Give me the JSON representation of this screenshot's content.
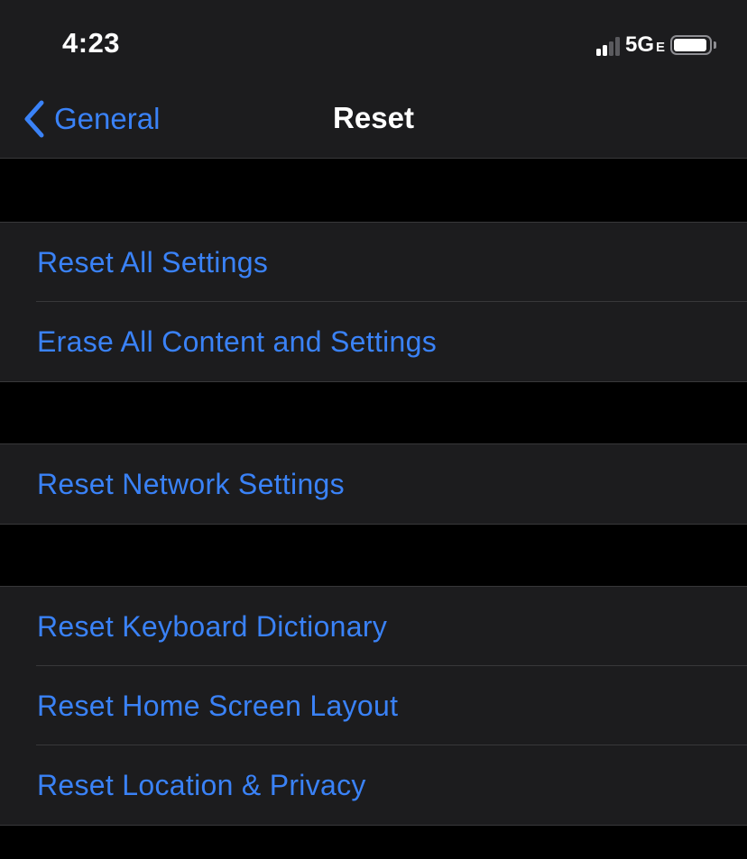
{
  "status_bar": {
    "time": "4:23",
    "network": "5G",
    "network_suffix": "E",
    "signal_bars_active": 2,
    "signal_bars_total": 4,
    "battery_level": 0.85
  },
  "nav": {
    "back_label": "General",
    "title": "Reset"
  },
  "groups": [
    {
      "items": [
        {
          "label": "Reset All Settings"
        },
        {
          "label": "Erase All Content and Settings"
        }
      ]
    },
    {
      "items": [
        {
          "label": "Reset Network Settings"
        }
      ]
    },
    {
      "items": [
        {
          "label": "Reset Keyboard Dictionary"
        },
        {
          "label": "Reset Home Screen Layout"
        },
        {
          "label": "Reset Location & Privacy"
        }
      ]
    }
  ],
  "colors": {
    "accent": "#3a82f7",
    "background": "#000000",
    "cell_background": "#1c1c1e",
    "separator": "#38383a",
    "text_primary": "#ffffff"
  },
  "icons": {
    "back": "chevron-left-icon",
    "signal": "cellular-signal-icon",
    "battery": "battery-icon"
  }
}
